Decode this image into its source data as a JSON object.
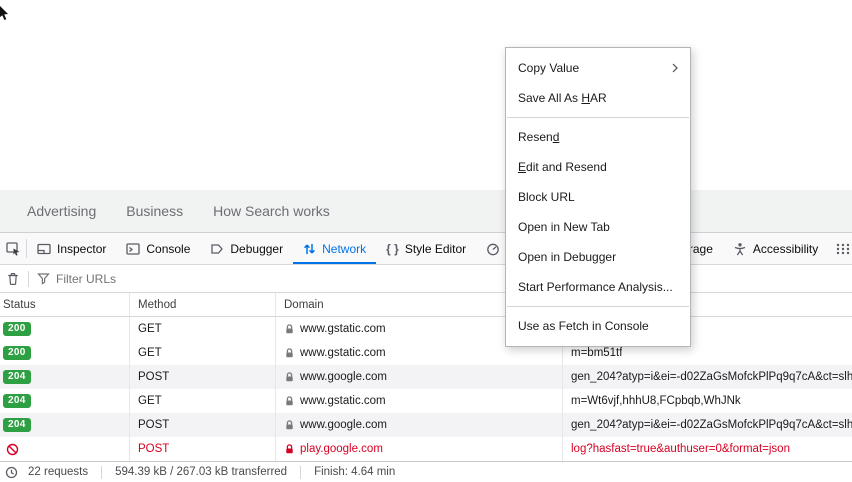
{
  "colors": {
    "accent_blue": "#0074e8",
    "status_green": "#2ea043",
    "error_red": "#d70022"
  },
  "page": {
    "footer_links": [
      {
        "label": "Advertising"
      },
      {
        "label": "Business"
      },
      {
        "label": "How Search works"
      }
    ]
  },
  "context_menu": {
    "items": [
      {
        "pre": "Copy Value",
        "key": "",
        "post": ""
      },
      {
        "pre": "Save All As ",
        "key": "H",
        "post": "AR"
      },
      {
        "pre": "Resen",
        "key": "d",
        "post": ""
      },
      {
        "pre": "",
        "key": "E",
        "post": "dit and Resend"
      },
      {
        "pre": "Block URL",
        "key": "",
        "post": ""
      },
      {
        "pre": "Open in New Tab",
        "key": "",
        "post": ""
      },
      {
        "pre": "Open in Debugger",
        "key": "",
        "post": ""
      },
      {
        "pre": "Start Performance Analysis...",
        "key": "",
        "post": ""
      },
      {
        "pre": "Use as Fetch in Console",
        "key": "",
        "post": ""
      }
    ]
  },
  "devtools": {
    "tabs": [
      {
        "label": "Inspector"
      },
      {
        "label": "Console"
      },
      {
        "label": "Debugger"
      },
      {
        "label": "Network"
      },
      {
        "label": "Style Editor"
      },
      {
        "label": "Performance"
      },
      {
        "label": "Storage"
      },
      {
        "label": "Accessibility"
      }
    ],
    "filter": {
      "placeholder": "Filter URLs"
    },
    "table": {
      "headers": {
        "status": "Status",
        "method": "Method",
        "domain": "Domain",
        "file": ""
      },
      "rows": [
        {
          "status": "200",
          "method": "GET",
          "domain": "www.gstatic.com",
          "file": ""
        },
        {
          "status": "200",
          "method": "GET",
          "domain": "www.gstatic.com",
          "file": "m=bm51tf"
        },
        {
          "status": "204",
          "method": "POST",
          "domain": "www.google.com",
          "file": "gen_204?atyp=i&ei=-d02ZaGsMofckPlPq9q7cA&ct=slh"
        },
        {
          "status": "204",
          "method": "GET",
          "domain": "www.gstatic.com",
          "file": "m=Wt6vjf,hhhU8,FCpbqb,WhJNk"
        },
        {
          "status": "204",
          "method": "POST",
          "domain": "www.google.com",
          "file": "gen_204?atyp=i&ei=-d02ZaGsMofckPlPq9q7cA&ct=slh"
        },
        {
          "status": "",
          "method": "POST",
          "domain": "play.google.com",
          "file": "log?hasfast=true&authuser=0&format=json"
        }
      ]
    },
    "statusbar": {
      "requests": "22 requests",
      "transferred": "594.39 kB / 267.03 kB transferred",
      "finish": "Finish: 4.64 min"
    }
  }
}
